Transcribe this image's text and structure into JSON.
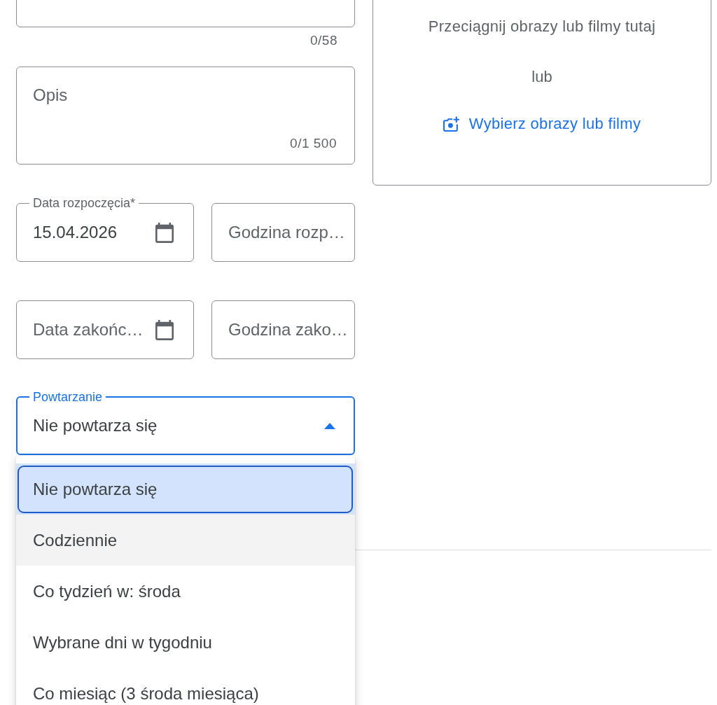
{
  "title_field": {
    "counter": "0/58"
  },
  "media_upload": {
    "hint": "Przeciągnij obrazy lub filmy tutaj",
    "separator": "lub",
    "button": "Wybierz obrazy lub filmy"
  },
  "description_field": {
    "placeholder": "Opis",
    "counter": "0/1 500"
  },
  "schedule": [
    {
      "date": {
        "label": "Data rozpoczęcia*",
        "value": "15.04.2026"
      },
      "time": {
        "placeholder": "Godzina rozp…"
      }
    },
    {
      "date": {
        "placeholder": "Data zakońc…"
      },
      "time": {
        "placeholder": "Godzina zako…"
      }
    }
  ],
  "repeat": {
    "label": "Powtarzanie",
    "value": "Nie powtarza się",
    "expanded": true,
    "options": [
      {
        "label": "Nie powtarza się",
        "selected": true,
        "hovered": false
      },
      {
        "label": "Codziennie",
        "selected": false,
        "hovered": true
      },
      {
        "label": "Co tydzień w: środa",
        "selected": false,
        "hovered": false
      },
      {
        "label": "Wybrane dni w tygodniu",
        "selected": false,
        "hovered": false
      },
      {
        "label": "Co miesiąc (3 środa miesiąca)",
        "selected": false,
        "hovered": false
      }
    ]
  }
}
